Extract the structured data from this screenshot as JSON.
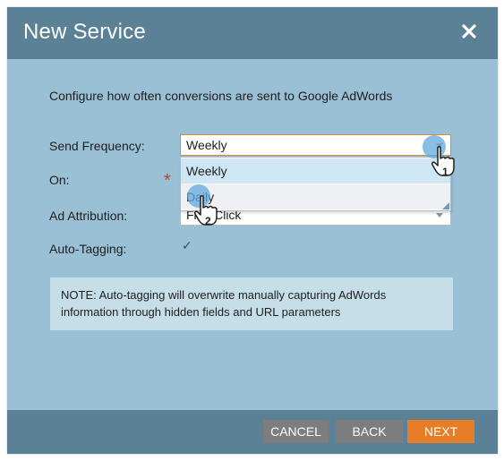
{
  "dialog": {
    "title": "New Service",
    "close_icon": "close-icon"
  },
  "intro": "Configure how often conversions are sent to Google AdWords",
  "fields": {
    "send_frequency": {
      "label": "Send Frequency:",
      "value": "Weekly",
      "options": [
        "Weekly",
        "Daily"
      ]
    },
    "on": {
      "label": "On:",
      "required_mark": "*"
    },
    "ad_attribution": {
      "label": "Ad Attribution:",
      "value": "First Click"
    },
    "auto_tagging": {
      "label": "Auto-Tagging:",
      "checked": true,
      "checkmark": "✓"
    }
  },
  "note": "NOTE:  Auto-tagging will overwrite manually capturing AdWords information through hidden fields and URL parameters",
  "buttons": {
    "cancel": "CANCEL",
    "back": "BACK",
    "next": "NEXT"
  },
  "callouts": {
    "step1": "1",
    "step2": "2"
  },
  "colors": {
    "header": "#5a8196",
    "body": "#99c0d4",
    "next_button": "#e87d28",
    "secondary_button": "#7d7d7d",
    "required": "#c0413b"
  }
}
